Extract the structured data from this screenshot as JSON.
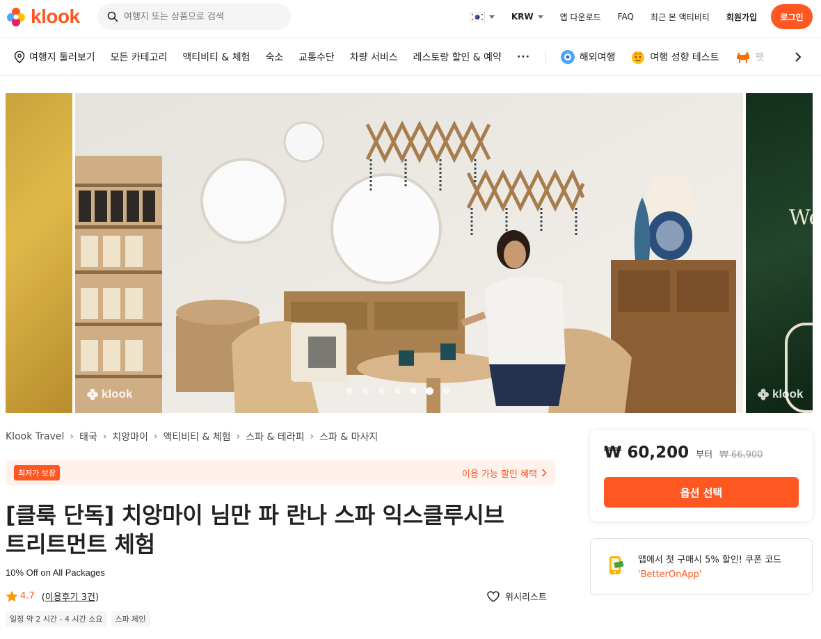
{
  "header": {
    "logo_text": "klook",
    "search_placeholder": "여행지 또는 상품으로 검색",
    "currency": "KRW",
    "app_download": "앱 다운로드",
    "faq": "FAQ",
    "recent": "최근 본 액티비티",
    "signup": "회원가입",
    "login": "로그인"
  },
  "categories": {
    "items": [
      "여행지 둘러보기",
      "모든 카테고리",
      "액티비티 & 체험",
      "숙소",
      "교통수단",
      "차량 서비스",
      "레스토랑 할인 & 예약"
    ],
    "more": "···",
    "promo_items": [
      "해외여행",
      "여행 성향 테스트",
      "펫"
    ]
  },
  "gallery": {
    "watermark": "klook",
    "right_partial_text": "We",
    "dot_count": 7,
    "active_dot": 5
  },
  "breadcrumb": [
    "Klook Travel",
    "태국",
    "치앙마이",
    "액티비티 & 체험",
    "스파 & 테라피",
    "스파 & 마사지"
  ],
  "promo": {
    "badge": "최저가 보장",
    "link": "이용 가능 할인 혜택"
  },
  "product": {
    "title_line1": "[클룩 단독] 치앙마이 님만 파 란나 스파 익스클루시브",
    "title_line2": "트리트먼트 체험",
    "subtitle": "10% Off on All Packages",
    "rating": "4.7",
    "reviews_open": "(",
    "reviews": "이용후기 3건",
    "reviews_close": ")",
    "wishlist": "위시리스트",
    "tags": [
      "일정 약 2 시간 - 4 시간 소요",
      "스파 체인"
    ]
  },
  "price_card": {
    "price": "₩ 60,200",
    "from": "부터",
    "old_price": "₩ 66,900",
    "button": "옵션 선택"
  },
  "app_card": {
    "text": "앱에서 첫 구매시 5% 할인! 쿠폰 코드",
    "code": "'BetterOnApp'"
  },
  "colors": {
    "brand": "#ff5722",
    "promo_bg": "#fff1eb"
  }
}
